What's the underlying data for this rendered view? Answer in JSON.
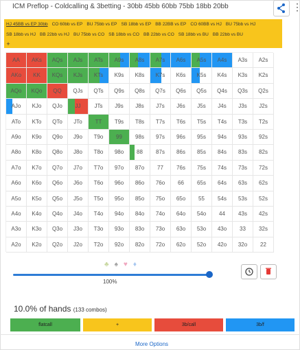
{
  "header": {
    "title": "ICM Preflop - Coldcalling & 3betting - 30bb 45bb 60bb 75bb 18bb 20bb",
    "share_icon": "share-icon",
    "more_icon": "more-vert-icon"
  },
  "scenarios": {
    "rows": [
      [
        "HJ 45BB vs EP 30bb",
        "CO 60bb vs EP",
        "BU 75bb vs EP",
        "SB 18bb vs EP",
        "BB 22BB vs EP",
        "CO 60BB vs HJ",
        "BU 75bb vs HJ"
      ],
      [
        "SB 18bb vs HJ",
        "BB 22bb vs HJ",
        "BU 75bb vs CO",
        "SB 18bb vs CO",
        "BB 22bb vs CO",
        "SB 18bb vs BU",
        "BB 22bb vs BU"
      ]
    ],
    "add_label": "+",
    "active": "HJ 45BB vs EP 30bb"
  },
  "colors": {
    "raise": "#e74c3c",
    "call": "#4caf50",
    "bet": "#2196f3",
    "empty": "#ffffff",
    "accent": "#2e7cd6",
    "scenario_bg": "#f8c51c"
  },
  "matrix": {
    "rows": [
      [
        {
          "t": "AA",
          "m": [
            [
              "r",
              1
            ]
          ]
        },
        {
          "t": "AKs",
          "m": [
            [
              "r",
              1
            ]
          ]
        },
        {
          "t": "AQs",
          "m": [
            [
              "c",
              1
            ]
          ]
        },
        {
          "t": "AJs",
          "m": [
            [
              "c",
              1
            ]
          ]
        },
        {
          "t": "ATs",
          "m": [
            [
              "c",
              1
            ]
          ]
        },
        {
          "t": "A9s",
          "m": [
            [
              "c",
              0.55
            ],
            [
              "b",
              0.45
            ]
          ]
        },
        {
          "t": "A8s",
          "m": [
            [
              "c",
              0.4
            ],
            [
              "b",
              0.6
            ]
          ]
        },
        {
          "t": "A7s",
          "m": [
            [
              "c",
              0.55
            ],
            [
              "b",
              0.45
            ]
          ]
        },
        {
          "t": "A6s",
          "m": [
            [
              "b",
              1
            ]
          ]
        },
        {
          "t": "A5s",
          "m": [
            [
              "c",
              0.4
            ],
            [
              "b",
              0.6
            ]
          ]
        },
        {
          "t": "A4s",
          "m": [
            [
              "b",
              1
            ]
          ]
        },
        {
          "t": "A3s",
          "m": []
        },
        {
          "t": "A2s",
          "m": []
        }
      ],
      [
        {
          "t": "AKo",
          "m": [
            [
              "r",
              1
            ]
          ]
        },
        {
          "t": "KK",
          "m": [
            [
              "r",
              1
            ]
          ]
        },
        {
          "t": "KQs",
          "m": [
            [
              "c",
              1
            ]
          ]
        },
        {
          "t": "KJs",
          "m": [
            [
              "c",
              1
            ]
          ]
        },
        {
          "t": "KTs",
          "m": [
            [
              "c",
              0.55
            ],
            [
              "b",
              0.45
            ]
          ]
        },
        {
          "t": "K9s",
          "m": []
        },
        {
          "t": "K8s",
          "m": []
        },
        {
          "t": "K7s",
          "m": [
            [
              "b",
              0.55
            ]
          ]
        },
        {
          "t": "K6s",
          "m": []
        },
        {
          "t": "K5s",
          "m": [
            [
              "b",
              0.4
            ]
          ]
        },
        {
          "t": "K4s",
          "m": []
        },
        {
          "t": "K3s",
          "m": []
        },
        {
          "t": "K2s",
          "m": []
        }
      ],
      [
        {
          "t": "AQo",
          "m": [
            [
              "c",
              1
            ]
          ]
        },
        {
          "t": "KQo",
          "m": [
            [
              "c",
              1
            ]
          ]
        },
        {
          "t": "QQ",
          "m": [
            [
              "r",
              1
            ]
          ]
        },
        {
          "t": "QJs",
          "m": []
        },
        {
          "t": "QTs",
          "m": []
        },
        {
          "t": "Q9s",
          "m": []
        },
        {
          "t": "Q8s",
          "m": []
        },
        {
          "t": "Q7s",
          "m": []
        },
        {
          "t": "Q6s",
          "m": []
        },
        {
          "t": "Q5s",
          "m": []
        },
        {
          "t": "Q4s",
          "m": []
        },
        {
          "t": "Q3s",
          "m": []
        },
        {
          "t": "Q2s",
          "m": []
        }
      ],
      [
        {
          "t": "AJo",
          "m": [
            [
              "b",
              0.3
            ]
          ]
        },
        {
          "t": "KJo",
          "m": []
        },
        {
          "t": "QJo",
          "m": []
        },
        {
          "t": "JJ",
          "m": [
            [
              "c",
              0.35
            ],
            [
              "r",
              0.65
            ]
          ]
        },
        {
          "t": "JTs",
          "m": []
        },
        {
          "t": "J9s",
          "m": []
        },
        {
          "t": "J8s",
          "m": []
        },
        {
          "t": "J7s",
          "m": []
        },
        {
          "t": "J6s",
          "m": []
        },
        {
          "t": "J5s",
          "m": []
        },
        {
          "t": "J4s",
          "m": []
        },
        {
          "t": "J3s",
          "m": []
        },
        {
          "t": "J2s",
          "m": []
        }
      ],
      [
        {
          "t": "ATo",
          "m": []
        },
        {
          "t": "KTo",
          "m": []
        },
        {
          "t": "QTo",
          "m": []
        },
        {
          "t": "JTo",
          "m": []
        },
        {
          "t": "TT",
          "m": [
            [
              "c",
              1
            ]
          ]
        },
        {
          "t": "T9s",
          "m": []
        },
        {
          "t": "T8s",
          "m": []
        },
        {
          "t": "T7s",
          "m": []
        },
        {
          "t": "T6s",
          "m": []
        },
        {
          "t": "T5s",
          "m": []
        },
        {
          "t": "T4s",
          "m": []
        },
        {
          "t": "T3s",
          "m": []
        },
        {
          "t": "T2s",
          "m": []
        }
      ],
      [
        {
          "t": "A9o",
          "m": []
        },
        {
          "t": "K9o",
          "m": []
        },
        {
          "t": "Q9o",
          "m": []
        },
        {
          "t": "J9o",
          "m": []
        },
        {
          "t": "T9o",
          "m": []
        },
        {
          "t": "99",
          "m": [
            [
              "c",
              1
            ]
          ]
        },
        {
          "t": "98s",
          "m": []
        },
        {
          "t": "97s",
          "m": []
        },
        {
          "t": "96s",
          "m": []
        },
        {
          "t": "95s",
          "m": []
        },
        {
          "t": "94s",
          "m": []
        },
        {
          "t": "93s",
          "m": []
        },
        {
          "t": "92s",
          "m": []
        }
      ],
      [
        {
          "t": "A8o",
          "m": []
        },
        {
          "t": "K8o",
          "m": []
        },
        {
          "t": "Q8o",
          "m": []
        },
        {
          "t": "J8o",
          "m": []
        },
        {
          "t": "T8o",
          "m": []
        },
        {
          "t": "98o",
          "m": []
        },
        {
          "t": "88",
          "m": [
            [
              "c",
              0.25
            ]
          ]
        },
        {
          "t": "87s",
          "m": []
        },
        {
          "t": "86s",
          "m": []
        },
        {
          "t": "85s",
          "m": []
        },
        {
          "t": "84s",
          "m": []
        },
        {
          "t": "83s",
          "m": []
        },
        {
          "t": "82s",
          "m": []
        }
      ],
      [
        {
          "t": "A7o",
          "m": []
        },
        {
          "t": "K7o",
          "m": []
        },
        {
          "t": "Q7o",
          "m": []
        },
        {
          "t": "J7o",
          "m": []
        },
        {
          "t": "T7o",
          "m": []
        },
        {
          "t": "97o",
          "m": []
        },
        {
          "t": "87o",
          "m": []
        },
        {
          "t": "77",
          "m": []
        },
        {
          "t": "76s",
          "m": []
        },
        {
          "t": "75s",
          "m": []
        },
        {
          "t": "74s",
          "m": []
        },
        {
          "t": "73s",
          "m": []
        },
        {
          "t": "72s",
          "m": []
        }
      ],
      [
        {
          "t": "A6o",
          "m": []
        },
        {
          "t": "K6o",
          "m": []
        },
        {
          "t": "Q6o",
          "m": []
        },
        {
          "t": "J6o",
          "m": []
        },
        {
          "t": "T6o",
          "m": []
        },
        {
          "t": "96o",
          "m": []
        },
        {
          "t": "86o",
          "m": []
        },
        {
          "t": "76o",
          "m": []
        },
        {
          "t": "66",
          "m": []
        },
        {
          "t": "65s",
          "m": []
        },
        {
          "t": "64s",
          "m": []
        },
        {
          "t": "63s",
          "m": []
        },
        {
          "t": "62s",
          "m": []
        }
      ],
      [
        {
          "t": "A5o",
          "m": []
        },
        {
          "t": "K5o",
          "m": []
        },
        {
          "t": "Q5o",
          "m": []
        },
        {
          "t": "J5o",
          "m": []
        },
        {
          "t": "T5o",
          "m": []
        },
        {
          "t": "95o",
          "m": []
        },
        {
          "t": "85o",
          "m": []
        },
        {
          "t": "75o",
          "m": []
        },
        {
          "t": "65o",
          "m": []
        },
        {
          "t": "55",
          "m": []
        },
        {
          "t": "54s",
          "m": []
        },
        {
          "t": "53s",
          "m": []
        },
        {
          "t": "52s",
          "m": []
        }
      ],
      [
        {
          "t": "A4o",
          "m": []
        },
        {
          "t": "K4o",
          "m": []
        },
        {
          "t": "Q4o",
          "m": []
        },
        {
          "t": "J4o",
          "m": []
        },
        {
          "t": "T4o",
          "m": []
        },
        {
          "t": "94o",
          "m": []
        },
        {
          "t": "84o",
          "m": []
        },
        {
          "t": "74o",
          "m": []
        },
        {
          "t": "64o",
          "m": []
        },
        {
          "t": "54o",
          "m": []
        },
        {
          "t": "44",
          "m": []
        },
        {
          "t": "43s",
          "m": []
        },
        {
          "t": "42s",
          "m": []
        }
      ],
      [
        {
          "t": "A3o",
          "m": []
        },
        {
          "t": "K3o",
          "m": []
        },
        {
          "t": "Q3o",
          "m": []
        },
        {
          "t": "J3o",
          "m": []
        },
        {
          "t": "T3o",
          "m": []
        },
        {
          "t": "93o",
          "m": []
        },
        {
          "t": "83o",
          "m": []
        },
        {
          "t": "73o",
          "m": []
        },
        {
          "t": "63o",
          "m": []
        },
        {
          "t": "53o",
          "m": []
        },
        {
          "t": "43o",
          "m": []
        },
        {
          "t": "33",
          "m": []
        },
        {
          "t": "32s",
          "m": []
        }
      ],
      [
        {
          "t": "A2o",
          "m": []
        },
        {
          "t": "K2o",
          "m": []
        },
        {
          "t": "Q2o",
          "m": []
        },
        {
          "t": "J2o",
          "m": []
        },
        {
          "t": "T2o",
          "m": []
        },
        {
          "t": "92o",
          "m": []
        },
        {
          "t": "82o",
          "m": []
        },
        {
          "t": "72o",
          "m": []
        },
        {
          "t": "62o",
          "m": []
        },
        {
          "t": "52o",
          "m": []
        },
        {
          "t": "42o",
          "m": []
        },
        {
          "t": "32o",
          "m": []
        },
        {
          "t": "22",
          "m": []
        }
      ]
    ]
  },
  "controls": {
    "suits": [
      {
        "glyph": "♣",
        "color": "#c8d8a0"
      },
      {
        "glyph": "♠",
        "color": "#a0a0a0"
      },
      {
        "glyph": "♥",
        "color": "#f0a8c0"
      },
      {
        "glyph": "♦",
        "color": "#a8c8f0"
      }
    ],
    "slider_value": 1.0,
    "slider_label": "100%",
    "reset_icon": "history-icon",
    "delete_icon": "trash-icon"
  },
  "summary": {
    "hands_text": "10.0% of hands",
    "combos_text": "(133 combos)"
  },
  "actions": [
    {
      "label": "flatcall",
      "color": "#4caf50"
    },
    {
      "label": "+",
      "color": "#f8c51c"
    },
    {
      "label": "3b/call",
      "color": "#e74c3c"
    },
    {
      "label": "3b/f",
      "color": "#2196f3"
    }
  ],
  "footer": {
    "more_options": "More Options"
  }
}
